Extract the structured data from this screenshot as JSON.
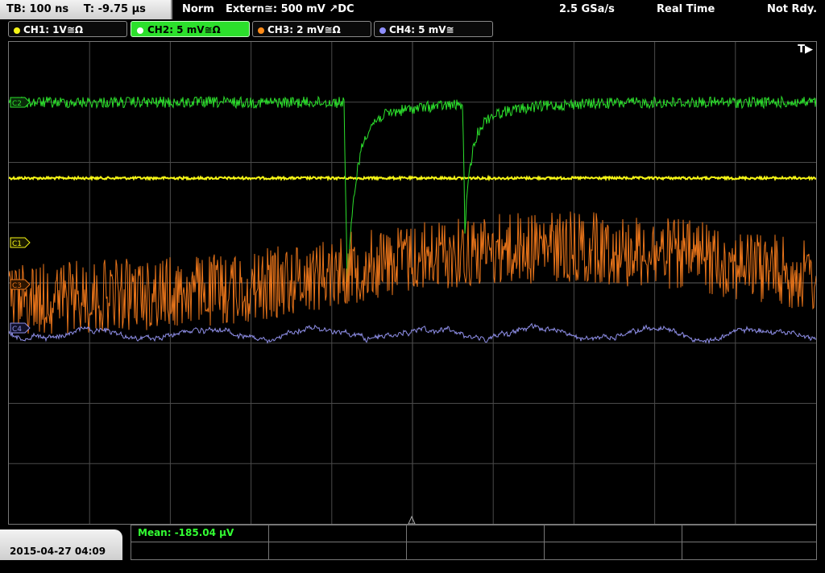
{
  "header": {
    "timebase": "TB: 100 ns",
    "trigger_time": "T: -9.75 µs",
    "mode": "Norm",
    "trigger": "Extern≅: 500 mV ↗DC",
    "sample_rate": "2.5 GSa/s",
    "acq_mode": "Real Time",
    "status": "Not Rdy."
  },
  "channels": [
    {
      "label": "CH1: 1V≅Ω",
      "color": "#f5f516",
      "active": false
    },
    {
      "label": "CH2: 5 mV≅Ω",
      "color": "#2ce02c",
      "active": true
    },
    {
      "label": "CH3: 2 mV≅Ω",
      "color": "#ff8c1a",
      "active": false
    },
    {
      "label": "CH4: 5 mV≅",
      "color": "#8f8fff",
      "active": false
    }
  ],
  "markers": {
    "c1": "C1",
    "c2": "C2",
    "c3": "C3",
    "c4": "C4",
    "trigger_pos": "T▶"
  },
  "measurement": {
    "text": "Mean: -185.04 µV"
  },
  "footer": {
    "datetime": "2015-04-27 04:09"
  },
  "colors": {
    "ch1": "#f5f516",
    "ch2": "#2ce02c",
    "ch3": "#e8741a",
    "ch4": "#8f8fe8",
    "grid": "#4a4a4a"
  }
}
